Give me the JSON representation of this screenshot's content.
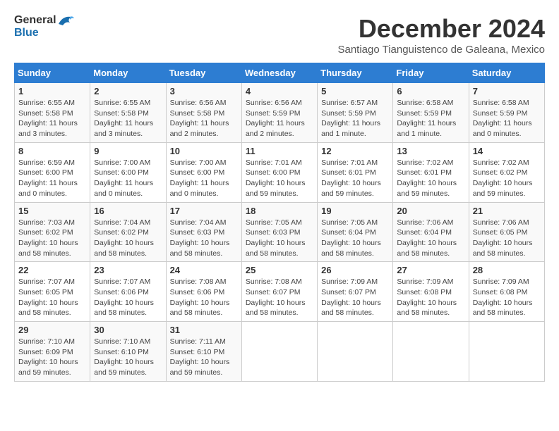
{
  "header": {
    "logo_text_general": "General",
    "logo_text_blue": "Blue",
    "month_title": "December 2024",
    "location": "Santiago Tianguistenco de Galeana, Mexico"
  },
  "calendar": {
    "days_of_week": [
      "Sunday",
      "Monday",
      "Tuesday",
      "Wednesday",
      "Thursday",
      "Friday",
      "Saturday"
    ],
    "weeks": [
      [
        {
          "day": "1",
          "info": "Sunrise: 6:55 AM\nSunset: 5:58 PM\nDaylight: 11 hours and 3 minutes."
        },
        {
          "day": "2",
          "info": "Sunrise: 6:55 AM\nSunset: 5:58 PM\nDaylight: 11 hours and 3 minutes."
        },
        {
          "day": "3",
          "info": "Sunrise: 6:56 AM\nSunset: 5:58 PM\nDaylight: 11 hours and 2 minutes."
        },
        {
          "day": "4",
          "info": "Sunrise: 6:56 AM\nSunset: 5:59 PM\nDaylight: 11 hours and 2 minutes."
        },
        {
          "day": "5",
          "info": "Sunrise: 6:57 AM\nSunset: 5:59 PM\nDaylight: 11 hours and 1 minute."
        },
        {
          "day": "6",
          "info": "Sunrise: 6:58 AM\nSunset: 5:59 PM\nDaylight: 11 hours and 1 minute."
        },
        {
          "day": "7",
          "info": "Sunrise: 6:58 AM\nSunset: 5:59 PM\nDaylight: 11 hours and 0 minutes."
        }
      ],
      [
        {
          "day": "8",
          "info": "Sunrise: 6:59 AM\nSunset: 6:00 PM\nDaylight: 11 hours and 0 minutes."
        },
        {
          "day": "9",
          "info": "Sunrise: 7:00 AM\nSunset: 6:00 PM\nDaylight: 11 hours and 0 minutes."
        },
        {
          "day": "10",
          "info": "Sunrise: 7:00 AM\nSunset: 6:00 PM\nDaylight: 11 hours and 0 minutes."
        },
        {
          "day": "11",
          "info": "Sunrise: 7:01 AM\nSunset: 6:00 PM\nDaylight: 10 hours and 59 minutes."
        },
        {
          "day": "12",
          "info": "Sunrise: 7:01 AM\nSunset: 6:01 PM\nDaylight: 10 hours and 59 minutes."
        },
        {
          "day": "13",
          "info": "Sunrise: 7:02 AM\nSunset: 6:01 PM\nDaylight: 10 hours and 59 minutes."
        },
        {
          "day": "14",
          "info": "Sunrise: 7:02 AM\nSunset: 6:02 PM\nDaylight: 10 hours and 59 minutes."
        }
      ],
      [
        {
          "day": "15",
          "info": "Sunrise: 7:03 AM\nSunset: 6:02 PM\nDaylight: 10 hours and 58 minutes."
        },
        {
          "day": "16",
          "info": "Sunrise: 7:04 AM\nSunset: 6:02 PM\nDaylight: 10 hours and 58 minutes."
        },
        {
          "day": "17",
          "info": "Sunrise: 7:04 AM\nSunset: 6:03 PM\nDaylight: 10 hours and 58 minutes."
        },
        {
          "day": "18",
          "info": "Sunrise: 7:05 AM\nSunset: 6:03 PM\nDaylight: 10 hours and 58 minutes."
        },
        {
          "day": "19",
          "info": "Sunrise: 7:05 AM\nSunset: 6:04 PM\nDaylight: 10 hours and 58 minutes."
        },
        {
          "day": "20",
          "info": "Sunrise: 7:06 AM\nSunset: 6:04 PM\nDaylight: 10 hours and 58 minutes."
        },
        {
          "day": "21",
          "info": "Sunrise: 7:06 AM\nSunset: 6:05 PM\nDaylight: 10 hours and 58 minutes."
        }
      ],
      [
        {
          "day": "22",
          "info": "Sunrise: 7:07 AM\nSunset: 6:05 PM\nDaylight: 10 hours and 58 minutes."
        },
        {
          "day": "23",
          "info": "Sunrise: 7:07 AM\nSunset: 6:06 PM\nDaylight: 10 hours and 58 minutes."
        },
        {
          "day": "24",
          "info": "Sunrise: 7:08 AM\nSunset: 6:06 PM\nDaylight: 10 hours and 58 minutes."
        },
        {
          "day": "25",
          "info": "Sunrise: 7:08 AM\nSunset: 6:07 PM\nDaylight: 10 hours and 58 minutes."
        },
        {
          "day": "26",
          "info": "Sunrise: 7:09 AM\nSunset: 6:07 PM\nDaylight: 10 hours and 58 minutes."
        },
        {
          "day": "27",
          "info": "Sunrise: 7:09 AM\nSunset: 6:08 PM\nDaylight: 10 hours and 58 minutes."
        },
        {
          "day": "28",
          "info": "Sunrise: 7:09 AM\nSunset: 6:08 PM\nDaylight: 10 hours and 58 minutes."
        }
      ],
      [
        {
          "day": "29",
          "info": "Sunrise: 7:10 AM\nSunset: 6:09 PM\nDaylight: 10 hours and 59 minutes."
        },
        {
          "day": "30",
          "info": "Sunrise: 7:10 AM\nSunset: 6:10 PM\nDaylight: 10 hours and 59 minutes."
        },
        {
          "day": "31",
          "info": "Sunrise: 7:11 AM\nSunset: 6:10 PM\nDaylight: 10 hours and 59 minutes."
        },
        {
          "day": "",
          "info": ""
        },
        {
          "day": "",
          "info": ""
        },
        {
          "day": "",
          "info": ""
        },
        {
          "day": "",
          "info": ""
        }
      ]
    ]
  }
}
